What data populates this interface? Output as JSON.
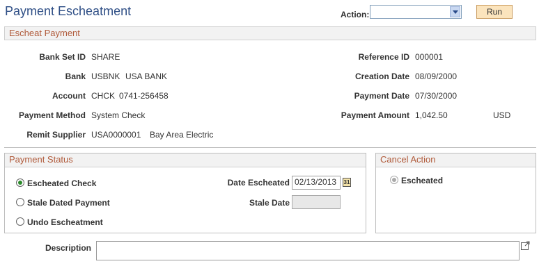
{
  "page": {
    "title": "Payment Escheatment"
  },
  "toolbar": {
    "action_label": "Action:",
    "action_value": "",
    "run_label": "Run"
  },
  "escheat": {
    "header": "Escheat Payment",
    "bank_set_id": {
      "label": "Bank Set ID",
      "value": "SHARE"
    },
    "bank": {
      "label": "Bank",
      "code": "USBNK",
      "name": "USA BANK"
    },
    "account": {
      "label": "Account",
      "code": "CHCK",
      "number": "0741-256458"
    },
    "payment_method": {
      "label": "Payment Method",
      "value": "System Check"
    },
    "remit_supplier": {
      "label": "Remit Supplier",
      "id": "USA0000001",
      "name": "Bay Area Electric"
    },
    "reference_id": {
      "label": "Reference ID",
      "value": "000001"
    },
    "creation_date": {
      "label": "Creation Date",
      "value": "08/09/2000"
    },
    "payment_date": {
      "label": "Payment Date",
      "value": "07/30/2000"
    },
    "payment_amount": {
      "label": "Payment Amount",
      "value": "1,042.50",
      "currency": "USD"
    }
  },
  "payment_status": {
    "header": "Payment Status",
    "options": [
      {
        "label": "Escheated Check",
        "selected": true
      },
      {
        "label": "Stale Dated Payment",
        "selected": false
      },
      {
        "label": "Undo Escheatment",
        "selected": false
      }
    ],
    "date_escheated": {
      "label": "Date Escheated",
      "value": "02/13/2013",
      "calendar_icon": "31"
    },
    "stale_date": {
      "label": "Stale Date",
      "value": ""
    }
  },
  "cancel_action": {
    "header": "Cancel Action",
    "option": {
      "label": "Escheated",
      "selected": true
    }
  },
  "description": {
    "label": "Description",
    "value": ""
  },
  "colors": {
    "title": "#2f4f86",
    "section_text": "#b05a3a",
    "run_button": "#fbe4bd",
    "radio_selected": "#2a8a2a"
  }
}
